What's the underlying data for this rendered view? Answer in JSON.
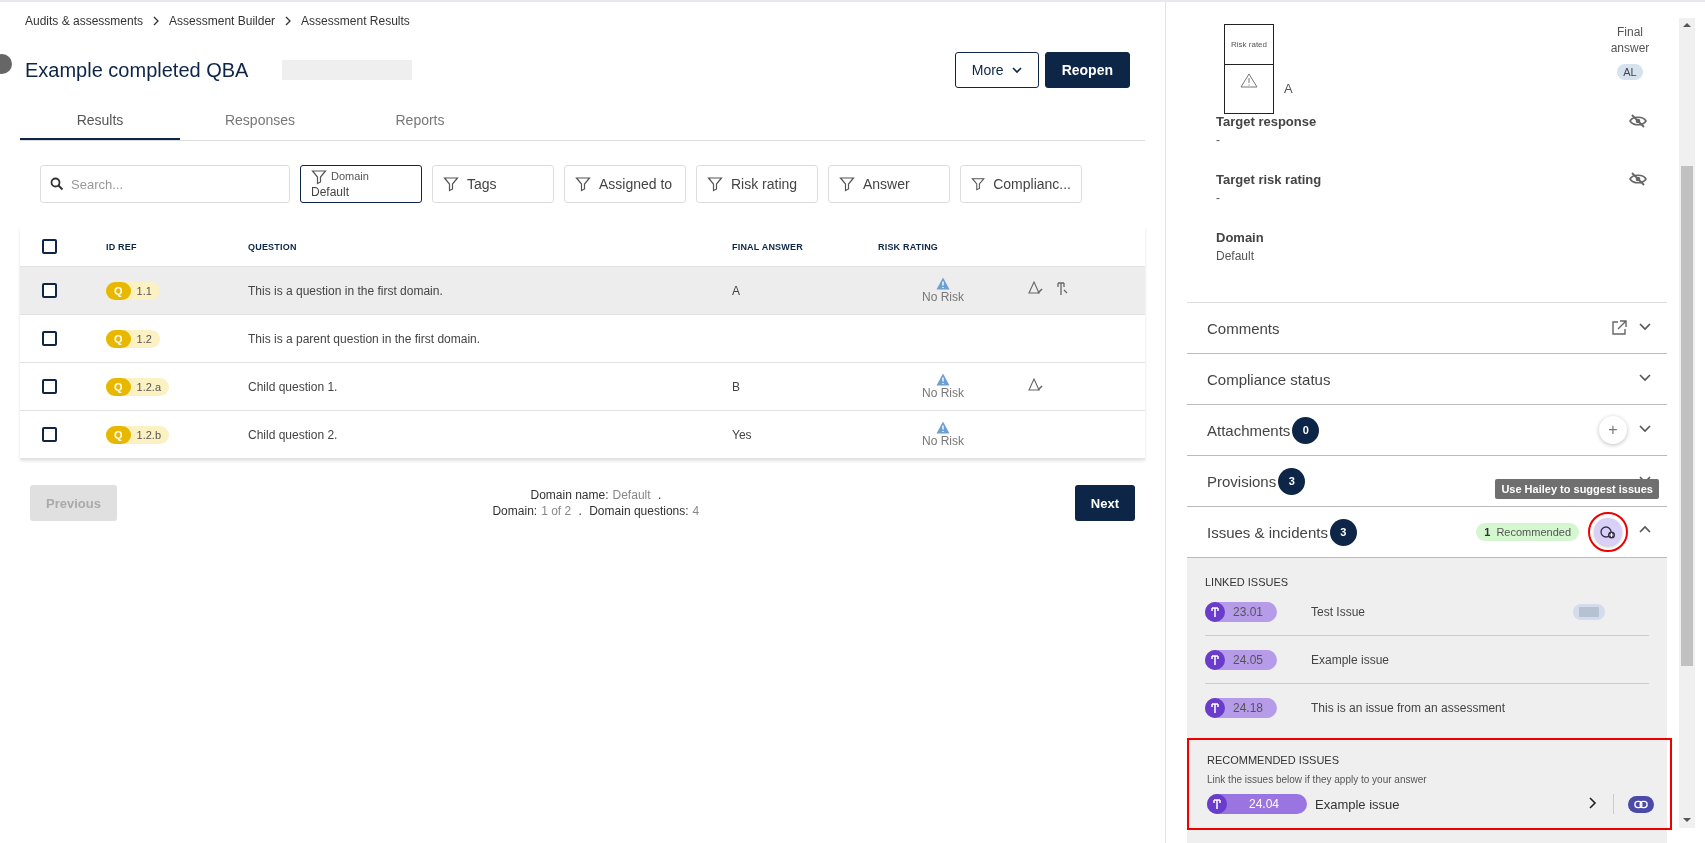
{
  "breadcrumbs": [
    "Audits & assessments",
    "Assessment Builder",
    "Assessment Results"
  ],
  "title": "Example completed QBA",
  "actions": [
    {
      "label": "More",
      "kind": "menu"
    },
    {
      "label": "Reopen",
      "kind": "primary"
    }
  ],
  "tabs": [
    {
      "label": "Results",
      "selected": true
    },
    {
      "label": "Responses",
      "selected": false
    },
    {
      "label": "Reports",
      "selected": false
    }
  ],
  "search": {
    "placeholder": "Search..."
  },
  "filters": [
    {
      "label": "Domain",
      "value": "Default",
      "active": true
    },
    {
      "label": "Tags",
      "active": false
    },
    {
      "label": "Assigned to",
      "active": false
    },
    {
      "label": "Risk rating",
      "active": false
    },
    {
      "label": "Answer",
      "active": false
    },
    {
      "label": "Complianc...",
      "active": false
    }
  ],
  "table": {
    "all_checked": false,
    "columns": [
      "ID REF",
      "QUESTION",
      "FINAL ANSWER",
      "RISK RATING"
    ],
    "rows": [
      {
        "type": "Q",
        "ref": "1.1",
        "question": "This is a question in the first domain.",
        "answer": "A",
        "risk": "No Risk",
        "checked": false,
        "hovered": true,
        "risk_icon": true,
        "issue_icon": true
      },
      {
        "type": "Q",
        "ref": "1.2",
        "question": "This is a parent question in the first domain.",
        "checked": false,
        "hovered": false,
        "risk_icon": false,
        "issue_icon": false
      },
      {
        "type": "Q",
        "ref": "1.2.a",
        "question": "Child question 1.",
        "answer": "B",
        "risk": "No Risk",
        "checked": false,
        "hovered": false,
        "risk_icon": true,
        "issue_icon": false
      },
      {
        "type": "Q",
        "ref": "1.2.b",
        "question": "Child question 2.",
        "answer": "Yes",
        "risk": "No Risk",
        "checked": false,
        "hovered": false,
        "risk_icon": false,
        "issue_icon": false
      }
    ]
  },
  "pagination": {
    "previous": {
      "label": "Previous",
      "disabled": true
    },
    "next": {
      "label": "Next",
      "disabled": false
    },
    "domain_name_label": "Domain name:",
    "domain_name": "Default",
    "domain_label": "Domain:",
    "domain_value": "1 of 2",
    "questions_label": "Domain questions:",
    "questions_value": "4",
    "separators": [
      ".",
      "."
    ]
  },
  "detail": {
    "risk_box_label": "Risk rated",
    "answer": "A",
    "final_answer_label": "Final answer",
    "answerer_initials": "AL",
    "fields": [
      {
        "label": "Target response",
        "value": "-",
        "hidden": true
      },
      {
        "label": "Target risk rating",
        "value": "-",
        "hidden": true
      },
      {
        "label": "Domain",
        "value": "Default",
        "hidden": false
      }
    ]
  },
  "sections": [
    {
      "title": "Comments",
      "kind": "external",
      "expanded": false
    },
    {
      "title": "Compliance status",
      "kind": "plain",
      "expanded": false
    },
    {
      "title": "Attachments",
      "count": "0",
      "kind": "add",
      "add_label": "+",
      "expanded": false
    },
    {
      "title": "Provisions",
      "count": "3",
      "kind": "plain",
      "expanded": false
    },
    {
      "title": "Issues & incidents",
      "count": "3",
      "kind": "hailey",
      "expanded": true,
      "recommended_count": "1",
      "recommended_label": "Recommended",
      "tooltip": "Use Hailey to suggest issues",
      "highlighted": true
    }
  ],
  "linked_issues": {
    "heading": "LINKED ISSUES",
    "items": [
      {
        "ref": "23.01",
        "title": "Test Issue",
        "chip": true
      },
      {
        "ref": "24.05",
        "title": "Example issue",
        "chip": false
      },
      {
        "ref": "24.18",
        "title": "This is an issue from an assessment",
        "chip": false
      }
    ]
  },
  "recommended_issues": {
    "heading": "RECOMMENDED ISSUES",
    "hint": "Link the issues below if they apply to your answer",
    "highlighted": true,
    "items": [
      {
        "ref": "24.04",
        "title": "Example issue"
      }
    ]
  }
}
